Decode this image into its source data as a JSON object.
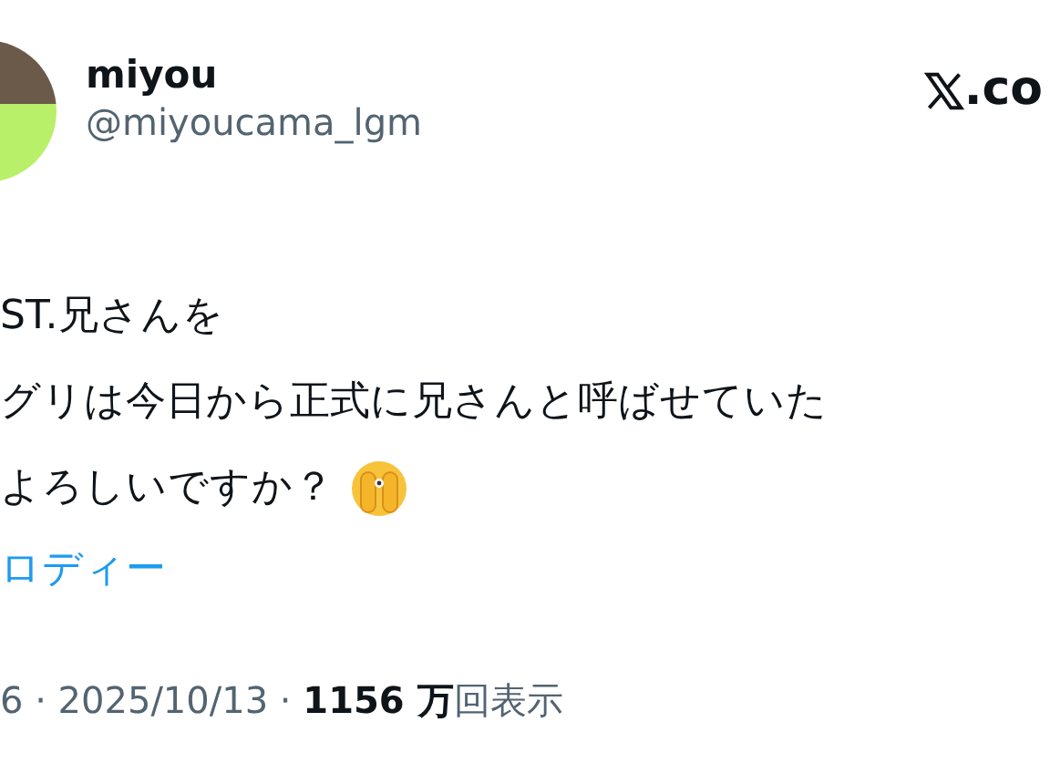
{
  "author": {
    "name": "miyou",
    "handle": "@miyoucama_lgm"
  },
  "watermark_site": ".co",
  "body_lines": [
    "ST.兄さんを",
    "グリは今日から正式に兄さんと呼ばせていた",
    "よろしいですか？"
  ],
  "label_link": "ロディー",
  "meta": "6 · 2025/10/13 · **1156 万**回表示"
}
